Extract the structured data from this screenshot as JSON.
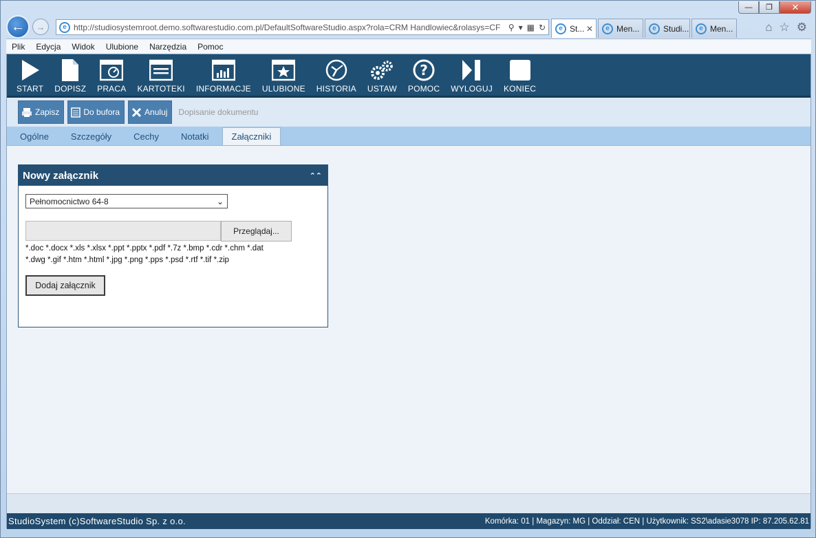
{
  "window": {
    "controls": [
      "—",
      "❐",
      "✕"
    ]
  },
  "browser": {
    "address": "http://studiosystemroot.demo.softwarestudio.com.pl/DefaultSoftwareStudio.aspx?rola=CRM Handlowiec&rolasys=CF",
    "tabs": [
      {
        "label": "St...",
        "active": true
      },
      {
        "label": "Men...",
        "active": false
      },
      {
        "label": "Studi...",
        "active": false
      },
      {
        "label": "Men...",
        "active": false
      }
    ]
  },
  "menu": {
    "items": [
      "Plik",
      "Edycja",
      "Widok",
      "Ulubione",
      "Narzędzia",
      "Pomoc"
    ]
  },
  "toolbar": {
    "buttons": [
      "START",
      "DOPISZ",
      "PRACA",
      "KARTOTEKI",
      "INFORMACJE",
      "ULUBIONE",
      "HISTORIA",
      "USTAW",
      "POMOC",
      "WYLOGUJ",
      "KONIEC"
    ]
  },
  "actions": {
    "save": "Zapisz",
    "buffer": "Do bufora",
    "cancel": "Anuluj",
    "crumb": "Dopisanie dokumentu"
  },
  "tabs": [
    "Ogólne",
    "Szczegóły",
    "Cechy",
    "Notatki",
    "Załączniki"
  ],
  "panel": {
    "title": "Nowy załącznik",
    "select_value": "Pełnomocnictwo 64-8",
    "browse_label": "Przeglądaj...",
    "extensions_line1": "*.doc *.docx *.xls *.xlsx *.ppt *.pptx *.pdf *.7z *.bmp *.cdr *.chm *.dat",
    "extensions_line2": "*.dwg *.gif *.htm *.html *.jpg *.png *.pps *.psd *.rtf *.tif *.zip",
    "add_label": "Dodaj załącznik"
  },
  "status": {
    "left": "StudioSystem (c)SoftwareStudio Sp. z o.o.",
    "right": "Komórka: 01 | Magazyn: MG | Oddział: CEN | Użytkownik: SS2\\adasie3078 IP: 87.205.62.81"
  }
}
